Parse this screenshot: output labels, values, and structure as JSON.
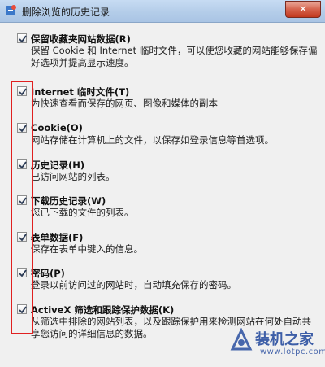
{
  "window": {
    "title": "删除浏览的历史记录",
    "close_glyph": "✕"
  },
  "options": [
    {
      "title": "保留收藏夹网站数据(R)",
      "desc": "保留 Cookie 和 Internet 临时文件，可以使您收藏的网站能够保存偏好选项并提高显示速度。",
      "checked": true
    },
    {
      "title": "Internet 临时文件(T)",
      "desc": "为快速查看而保存的网页、图像和媒体的副本",
      "checked": true
    },
    {
      "title": "Cookie(O)",
      "desc": "网站存储在计算机上的文件，以保存如登录信息等首选项。",
      "checked": true
    },
    {
      "title": "历史记录(H)",
      "desc": "已访问网站的列表。",
      "checked": true
    },
    {
      "title": "下载历史记录(W)",
      "desc": "您已下载的文件的列表。",
      "checked": true
    },
    {
      "title": "表单数据(F)",
      "desc": "保存在表单中键入的信息。",
      "checked": true
    },
    {
      "title": "密码(P)",
      "desc": "登录以前访问过的网站时，自动填充保存的密码。",
      "checked": true
    },
    {
      "title": "ActiveX 筛选和跟踪保护数据(K)",
      "desc": "从筛选中排除的网站列表，以及跟踪保护用来检测网站在何处自动共享您访问的详细信息的数据。",
      "checked": true
    }
  ],
  "watermark": {
    "title": "装机之家",
    "url": "www.lotpc.com"
  },
  "colors": {
    "highlight": "#e02020",
    "watermark": "#2a4fa0"
  }
}
